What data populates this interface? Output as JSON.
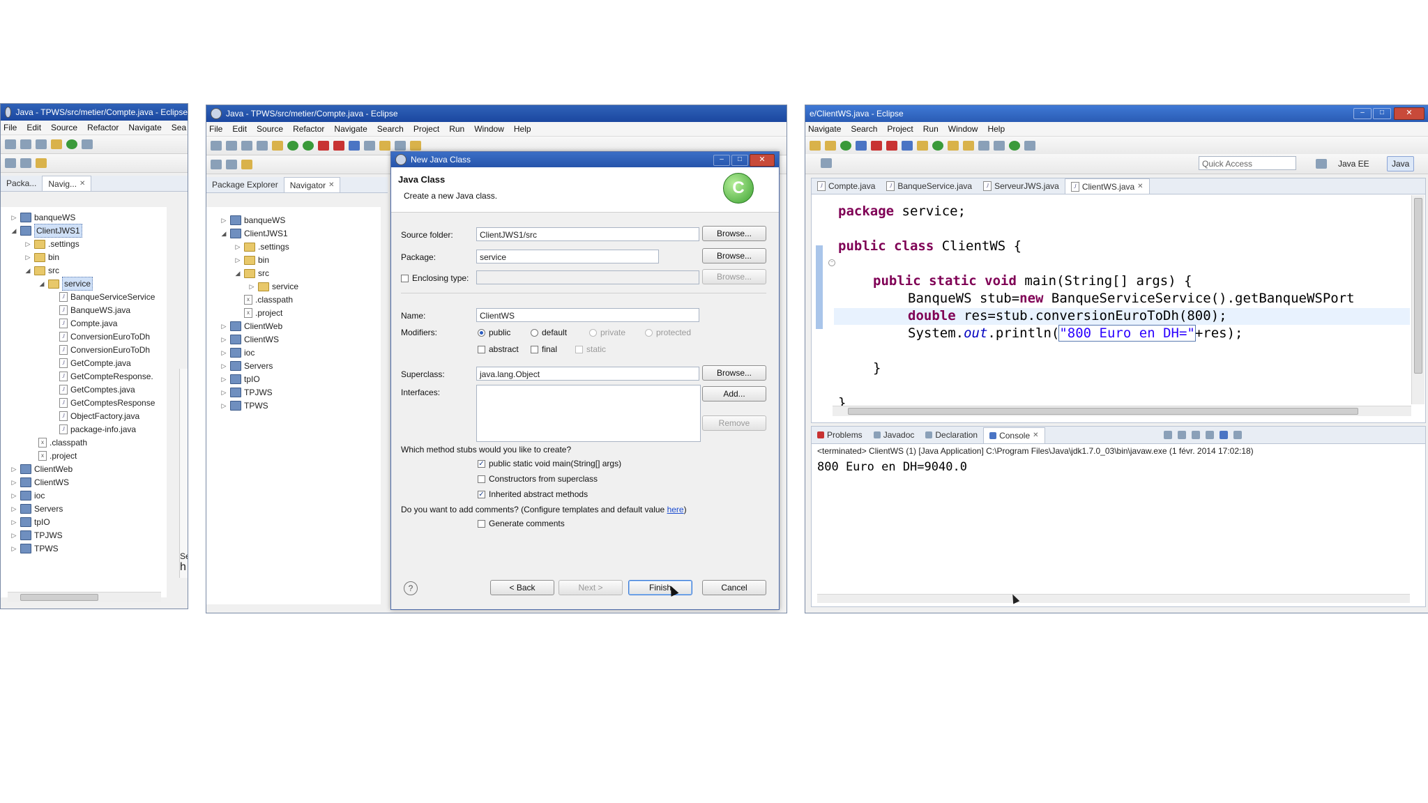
{
  "panel_left": {
    "title": "Java - TPWS/src/metier/Compte.java - Eclipse",
    "menu": [
      "File",
      "Edit",
      "Source",
      "Refactor",
      "Navigate",
      "Sea"
    ],
    "tabs": [
      "Packa...",
      "Navig..."
    ],
    "tree": [
      "banqueWS",
      "ClientJWS1",
      ".settings",
      "bin",
      "src",
      "service",
      "BanqueServiceService",
      "BanqueWS.java",
      "Compte.java",
      "ConversionEuroToDh",
      "ConversionEuroToDh",
      "GetCompte.java",
      "GetCompteResponse.",
      "GetComptes.java",
      "GetComptesResponse",
      "ObjectFactory.java",
      "package-info.java",
      ".classpath",
      ".project",
      "ClientWeb",
      "ClientWS",
      "ioc",
      "Servers",
      "tpIO",
      "TPJWS",
      "TPWS"
    ],
    "side_peek": [
      "Se",
      "h"
    ]
  },
  "panel_mid": {
    "title": "Java - TPWS/src/metier/Compte.java - Eclipse",
    "menu": [
      "File",
      "Edit",
      "Source",
      "Refactor",
      "Navigate",
      "Search",
      "Project",
      "Run",
      "Window",
      "Help"
    ],
    "tabs": [
      "Package Explorer",
      "Navigator"
    ],
    "tree": [
      "banqueWS",
      "ClientJWS1",
      ".settings",
      "bin",
      "src",
      "service",
      ".classpath",
      ".project",
      "ClientWeb",
      "ClientWS",
      "ioc",
      "Servers",
      "tpIO",
      "TPJWS",
      "TPWS"
    ]
  },
  "dialog": {
    "title": "New Java Class",
    "heading": "Java Class",
    "subheading": "Create a new Java class.",
    "source_folder_label": "Source folder:",
    "source_folder": "ClientJWS1/src",
    "package_label": "Package:",
    "package": "service",
    "enclosing_label": "Enclosing type:",
    "name_label": "Name:",
    "name": "ClientWS",
    "modifiers_label": "Modifiers:",
    "modifiers": [
      "public",
      "default",
      "private",
      "protected"
    ],
    "modifiers2": [
      "abstract",
      "final",
      "static"
    ],
    "superclass_label": "Superclass:",
    "superclass": "java.lang.Object",
    "interfaces_label": "Interfaces:",
    "browse": "Browse...",
    "add": "Add...",
    "remove": "Remove",
    "stubs_question": "Which method stubs would you like to create?",
    "stubs": [
      "public static void main(String[] args)",
      "Constructors from superclass",
      "Inherited abstract methods"
    ],
    "comments_question": "Do you want to add comments? (Configure templates and default value ",
    "comments_link": "here",
    "comments_end": ")",
    "generate_comments": "Generate comments",
    "help": "?",
    "back": "< Back",
    "next": "Next >",
    "finish": "Finish",
    "cancel": "Cancel"
  },
  "panel_right": {
    "title": "e/ClientWS.java - Eclipse",
    "menu": [
      "Navigate",
      "Search",
      "Project",
      "Run",
      "Window",
      "Help"
    ],
    "quick_access": "Quick Access",
    "perspectives": [
      "Java EE",
      "Java"
    ],
    "editor_tabs": [
      "Compte.java",
      "BanqueService.java",
      "ServeurJWS.java",
      "ClientWS.java"
    ],
    "code": {
      "l1_kw": "package",
      "l1_rest": " service;",
      "l2_kw": "public class",
      "l2_rest": " ClientWS {",
      "l3_kw": "public static void",
      "l3_rest": " main(String[] args) {",
      "l4": "BanqueWS stub=",
      "l4_kw": "new",
      "l4_rest": " BanqueServiceService().getBanqueWSPort",
      "l5_kw": "double",
      "l5_rest": " res=stub.conversionEuroToDh(800);",
      "l6_a": "System.",
      "l6_it": "out",
      "l6_b": ".println(",
      "l6_str": "\"800 Euro en DH=\"",
      "l6_c": "+res);",
      "l7": "}",
      "l8": "}"
    },
    "console_tabs": [
      "Problems",
      "Javadoc",
      "Declaration",
      "Console"
    ],
    "console_header": "<terminated> ClientWS (1) [Java Application] C:\\Program Files\\Java\\jdk1.7.0_03\\bin\\javaw.exe (1 févr. 2014 17:02:18)",
    "console_output": "800 Euro en DH=9040.0"
  },
  "colors": {
    "title_blue": "#1b47a0",
    "keyword": "#7f0055",
    "string": "#2a00ff",
    "field": "#0000c0"
  }
}
